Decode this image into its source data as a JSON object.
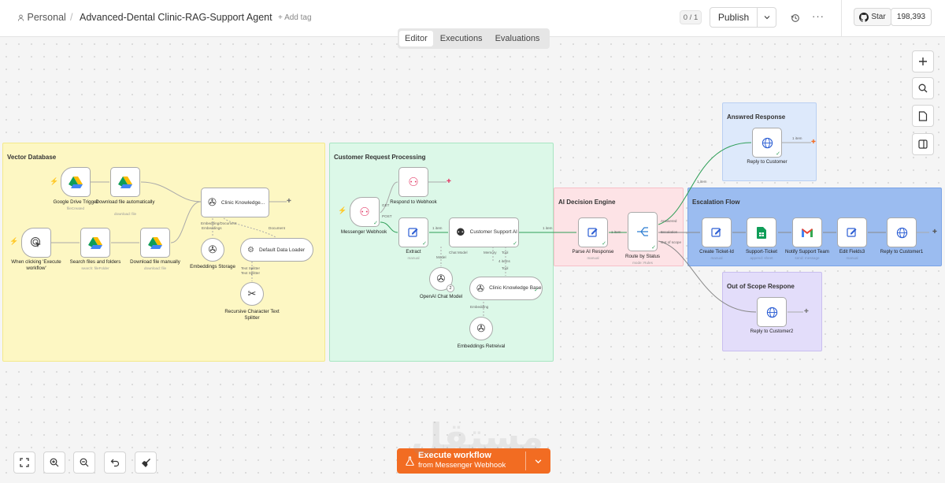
{
  "header": {
    "workspace": "Personal",
    "workflow_name": "Advanced-Dental Clinic-RAG-Support Agent",
    "add_tag": "+ Add tag",
    "counter": "0 / 1",
    "publish": "Publish",
    "star": "Star",
    "star_count": "198,393"
  },
  "tabs": [
    "Editor",
    "Executions",
    "Evaluations"
  ],
  "groups": {
    "vector": "Vector Database",
    "customer": "Customer Request Processing",
    "decision": "AI Decision Engine",
    "escalation": "Escalation Flow",
    "answered": "Answred Response",
    "outscope": "Out of Scope Respone"
  },
  "nodes": {
    "gdrive_trigger": {
      "label": "Google Drive Trigger",
      "sub": "fileCreated"
    },
    "download_auto": {
      "label": "Download file automatically",
      "sub": "download: file"
    },
    "clinic_kb1": {
      "label": "Clinic Knowledge..."
    },
    "manual_trigger": {
      "label": "When clicking 'Execute workflow'"
    },
    "search_files": {
      "label": "Search files and folders",
      "sub": "search: fileFolder"
    },
    "download_manual": {
      "label": "Download file manually",
      "sub": "download: file"
    },
    "embeddings_storage": {
      "label": "Embeddings Storage"
    },
    "default_loader": {
      "label": "Default Data Loader"
    },
    "text_splitter": {
      "label": "Recursive Character Text Splitter"
    },
    "messenger_webhook": {
      "label": "Messenger Webhook"
    },
    "respond_webhook": {
      "label": "Respond to Webhook"
    },
    "extract": {
      "label": "Extract",
      "sub": "manual"
    },
    "customer_ai": {
      "label": "Customer Support AI"
    },
    "openai_model": {
      "label": "OpenAI Chat Model"
    },
    "clinic_kb2": {
      "label": "Clinic Knowledge Base"
    },
    "embeddings_retrieval": {
      "label": "Embeddings Retreival"
    },
    "parse_ai": {
      "label": "Parse AI Response",
      "sub": "manual"
    },
    "route_status": {
      "label": "Route by Status",
      "sub": "mode: Rules"
    },
    "reply_customer": {
      "label": "Reply to Customer"
    },
    "create_ticket": {
      "label": "Create Ticket-Id",
      "sub": "manual"
    },
    "support_ticket": {
      "label": "Support-Ticket",
      "sub": "append: sheet"
    },
    "notify_team": {
      "label": "Notify Support Team",
      "sub": "send: message"
    },
    "edit_fields3": {
      "label": "Edit Fields3",
      "sub": "manual"
    },
    "reply_customer1": {
      "label": "Reply to Customer1"
    },
    "reply_customer2": {
      "label": "Reply to Customer2"
    }
  },
  "edge_labels": {
    "embedding_doc": "Embedding/Document",
    "embeddings": "Embeddings",
    "document": "Document",
    "text_splitter": "Text Splitter",
    "get": "GET",
    "post": "POST",
    "one_item": "1 item",
    "chat_model": "Chat Model",
    "model": "Model",
    "memory": "Memory",
    "tool": "Tool",
    "four_items": "4 items",
    "embedding": "Embedding",
    "answered": "Answered",
    "escalation": "Escalation",
    "out_of_scope": "Out of scope"
  },
  "execute": {
    "title": "Execute workflow",
    "subtitle": "from Messenger Webhook"
  },
  "model_badge": "2",
  "watermark": "مستقل",
  "colors": {
    "accent": "#f26c22",
    "vector_bg": "#fdf7c3",
    "customer_bg": "#dcf8e8",
    "decision_bg": "#fde3e6",
    "escalation_bg": "#9bbcf0",
    "answered_bg": "#dde9fb",
    "outscope_bg": "#e3ddfa",
    "edge": "#aaaaaa",
    "edge_green": "#2e9e57"
  },
  "icons": {
    "gdrive": "google-drive-icon",
    "edit": "edit-icon",
    "globe": "globe-icon",
    "webhook": "webhook-icon",
    "openai": "openai-icon",
    "gmail": "gmail-icon",
    "sheets": "google-sheets-icon",
    "router": "route-icon"
  }
}
